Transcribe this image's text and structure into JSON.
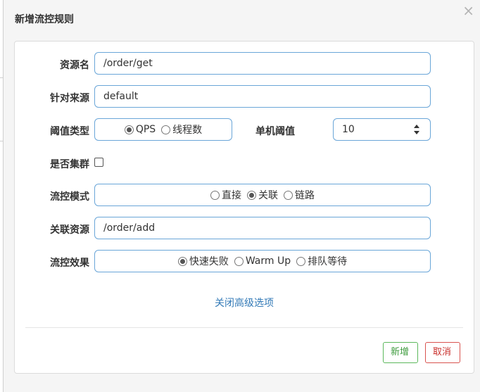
{
  "dialog": {
    "title": "新增流控规则",
    "close_symbol": "×"
  },
  "form": {
    "resource_name": {
      "label": "资源名",
      "value": "/order/get"
    },
    "limit_origin": {
      "label": "针对来源",
      "value": "default"
    },
    "threshold_type": {
      "label": "阈值类型",
      "options": [
        "QPS",
        "线程数"
      ],
      "selected": "QPS"
    },
    "single_threshold": {
      "label": "单机阈值",
      "value": "10"
    },
    "cluster_mode": {
      "label": "是否集群",
      "checked": false
    },
    "flow_mode": {
      "label": "流控模式",
      "options": [
        "直接",
        "关联",
        "链路"
      ],
      "selected": "关联"
    },
    "ref_resource": {
      "label": "关联资源",
      "value": "/order/add"
    },
    "control_behavior": {
      "label": "流控效果",
      "options": [
        "快速失败",
        "Warm Up",
        "排队等待"
      ],
      "selected": "快速失败"
    },
    "advanced_toggle": "关闭高级选项"
  },
  "footer": {
    "add_label": "新增",
    "cancel_label": "取消"
  },
  "colors": {
    "input_border": "#6aa6d8",
    "link": "#337ab7",
    "add_border": "#5cb85c",
    "cancel_border": "#d9534f"
  }
}
